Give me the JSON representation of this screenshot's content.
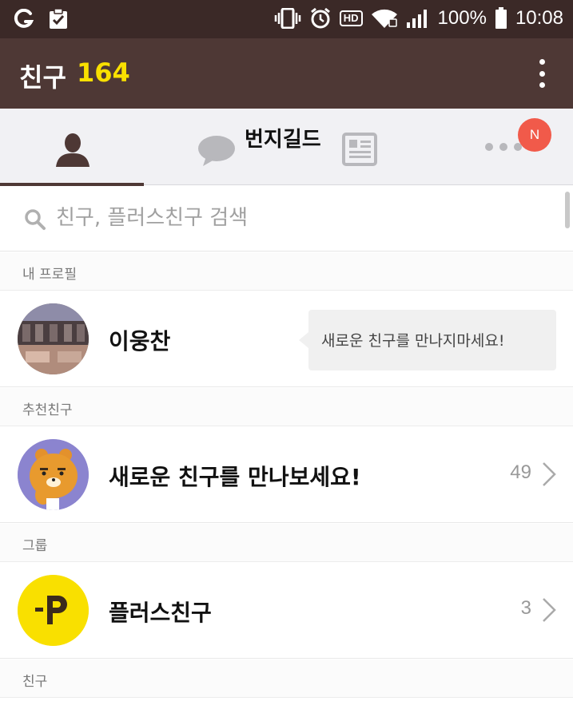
{
  "status_bar": {
    "battery": "100%",
    "time": "10:08",
    "hd": "HD"
  },
  "header": {
    "title": "친구",
    "count": "164",
    "menu_icon": "more-vertical-icon"
  },
  "tabs": [
    {
      "name": "friends",
      "icon": "person-icon",
      "active": true
    },
    {
      "name": "chat",
      "icon": "chat-bubble-icon",
      "active": false
    },
    {
      "name": "news",
      "icon": "newspaper-icon",
      "active": false
    },
    {
      "name": "more",
      "icon": "more-horizontal-icon",
      "active": false
    }
  ],
  "overlay_text": "번지길드",
  "badge": "N",
  "search": {
    "placeholder": "친구, 플러스친구 검색"
  },
  "sections": {
    "my_profile": "내 프로필",
    "recommended": "추천친구",
    "group": "그룹",
    "friends": "친구"
  },
  "my_profile": {
    "name": "이웅찬",
    "bubble": "새로운 친구를 만나지마세요!"
  },
  "recommended_row": {
    "name": "새로운 친구를 만나보세요!",
    "count": "49"
  },
  "plus_row": {
    "name": "플러스친구",
    "count": "3",
    "logo": "P"
  },
  "colors": {
    "status_bar": "#3b2927",
    "header": "#4e3835",
    "count_yellow": "#f9e000",
    "badge_red": "#f15a4a"
  }
}
